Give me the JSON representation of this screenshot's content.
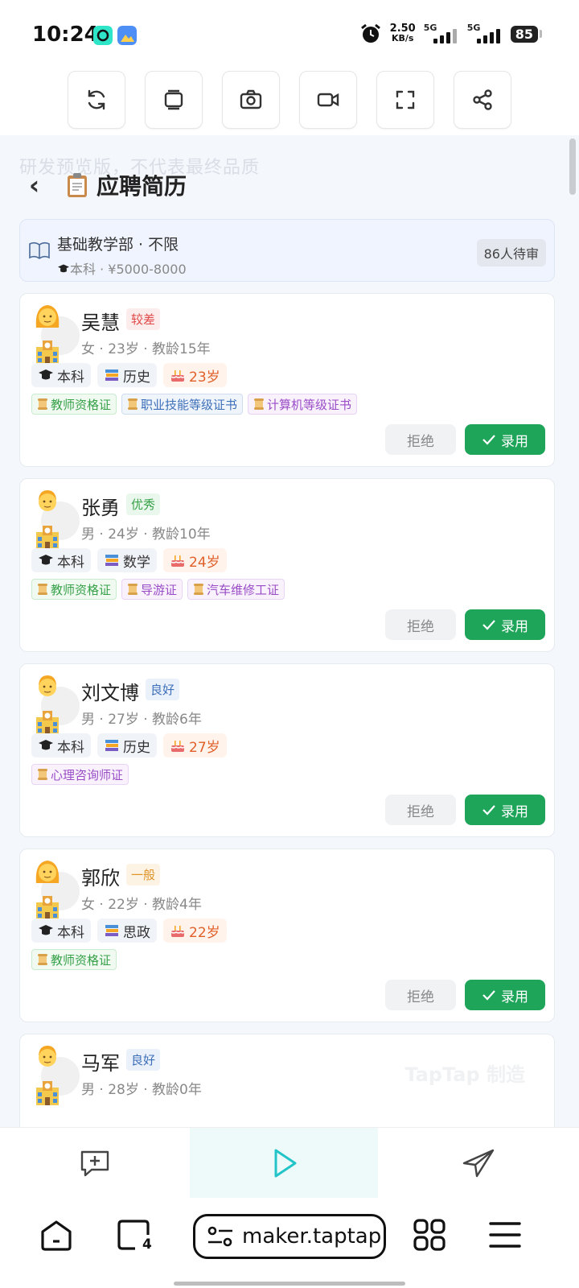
{
  "status_bar": {
    "time": "10:24",
    "net_speed_value": "2.50",
    "net_speed_unit": "KB/s",
    "sim1": "5G",
    "sim2": "5G",
    "battery": "85"
  },
  "toolbar": {
    "buttons": [
      "refresh-icon",
      "layers-icon",
      "camera-icon",
      "video-icon",
      "fullscreen-icon",
      "share-icon"
    ]
  },
  "page": {
    "watermark": "研发预览版，不代表最终品质",
    "back_label": "‹",
    "title": "应聘简历"
  },
  "job": {
    "title": "基础教学部 · 不限",
    "sub": "本科 · ¥5000-8000",
    "pending": "86人待审"
  },
  "candidates": [
    {
      "name": "吴慧",
      "rating": "较差",
      "info": "女 · 23岁 · 教龄15年",
      "education": "本科",
      "subject": "历史",
      "age": "23岁",
      "certs": [
        "教师资格证",
        "职业技能等级证书",
        "计算机等级证书"
      ],
      "reject": "拒绝",
      "hire": "录用"
    },
    {
      "name": "张勇",
      "rating": "优秀",
      "info": "男 · 24岁 · 教龄10年",
      "education": "本科",
      "subject": "数学",
      "age": "24岁",
      "certs": [
        "教师资格证",
        "导游证",
        "汽车维修工证"
      ],
      "reject": "拒绝",
      "hire": "录用"
    },
    {
      "name": "刘文博",
      "rating": "良好",
      "info": "男 · 27岁 · 教龄6年",
      "education": "本科",
      "subject": "历史",
      "age": "27岁",
      "certs": [
        "心理咨询师证"
      ],
      "reject": "拒绝",
      "hire": "录用"
    },
    {
      "name": "郭欣",
      "rating": "一般",
      "info": "女 · 22岁 · 教龄4年",
      "education": "本科",
      "subject": "思政",
      "age": "22岁",
      "certs": [
        "教师资格证"
      ],
      "reject": "拒绝",
      "hire": "录用"
    },
    {
      "name": "马军",
      "rating": "良好",
      "info": "男 · 28岁 · 教龄0年",
      "overlay": "TapTap 制造"
    }
  ],
  "browser": {
    "tab_count": "4",
    "url": "maker.taptap"
  },
  "colors": {
    "hire_green": "#1fa55a",
    "play_cyan": "#22c4c8",
    "app_background": "#f4f7fb"
  }
}
